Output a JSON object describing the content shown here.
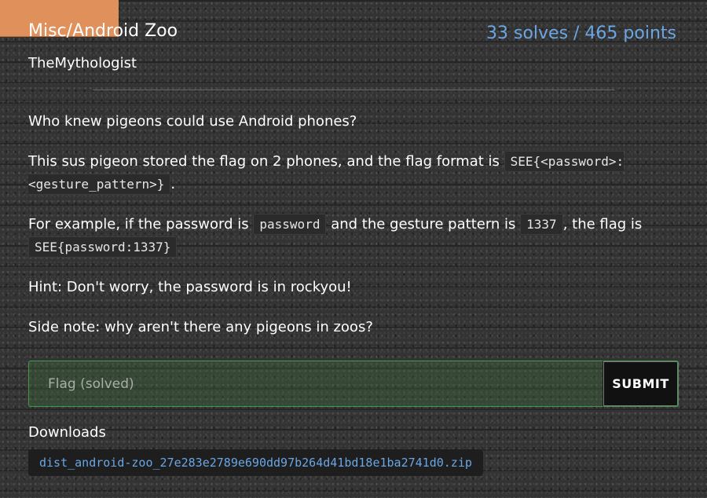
{
  "challenge": {
    "title": "Misc/Android Zoo",
    "solves": "33 solves / 465 points",
    "author": "TheMythologist"
  },
  "description": {
    "p1": "Who knew pigeons could use Android phones?",
    "p2_text": "This sus pigeon stored the flag on 2 phones, and the flag format is",
    "p2_code": "SEE{<password>:<gesture_pattern>}",
    "p2_end": ".",
    "p3_a": "For example, if the password is",
    "p3_code1": "password",
    "p3_b": "and the gesture pattern is",
    "p3_code2": "1337",
    "p3_c": ",",
    "p3_d": "the flag is",
    "p3_code3": "SEE{password:1337}",
    "p4": "Hint: Don't worry, the password is in rockyou!",
    "p5": "Side note: why aren't there any pigeons in zoos?"
  },
  "flag_form": {
    "placeholder": "Flag (solved)",
    "submit_label": "SUBMIT"
  },
  "downloads": {
    "heading": "Downloads",
    "file": "dist_android-zoo_27e283e2789e690dd97b264d41bd18e1ba2741d0.zip"
  },
  "colors": {
    "accent_tab": "#e0905a",
    "link_blue": "#6aa6e6",
    "solved_green": "#3f9a4f"
  }
}
